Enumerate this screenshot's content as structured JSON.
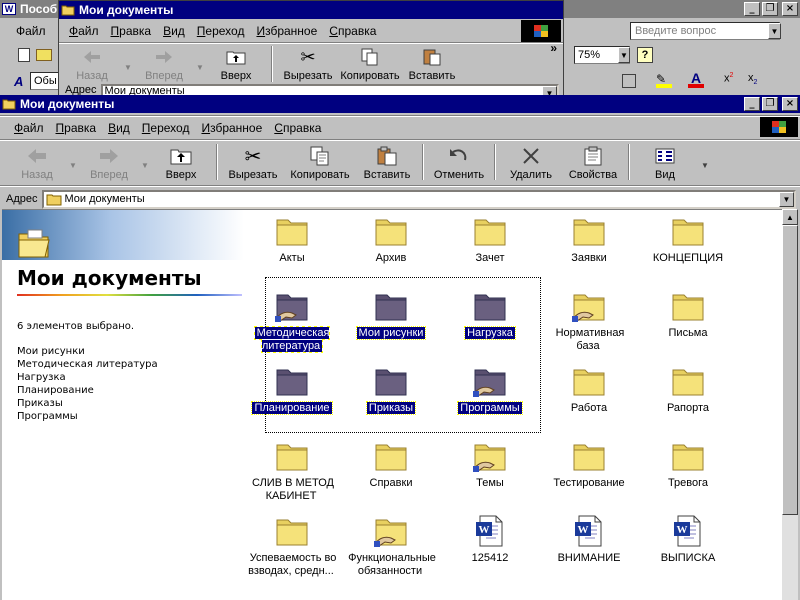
{
  "bg_word": {
    "title": "Пособ",
    "menu_file": "Файл",
    "toolbar2_label": "Обы",
    "help_placeholder": "Введите вопрос",
    "zoom": "75%"
  },
  "bg_explorer": {
    "title": "Мои документы",
    "menu": [
      "Файл",
      "Правка",
      "Вид",
      "Переход",
      "Избранное",
      "Справка"
    ],
    "toolbar": [
      "Назад",
      "Вперед",
      "Вверх",
      "Вырезать",
      "Копировать",
      "Вставить"
    ],
    "address_label": "Адрес",
    "address_value": "Мои документы",
    "more": "»"
  },
  "window": {
    "title": "Мои документы",
    "controls": [
      "_",
      "❐",
      "×"
    ],
    "menu": [
      "Файл",
      "Правка",
      "Вид",
      "Переход",
      "Избранное",
      "Справка"
    ],
    "toolbar": [
      {
        "label": "Назад",
        "icon": "back-arrow-icon"
      },
      {
        "label": "Вперед",
        "icon": "forward-arrow-icon"
      },
      {
        "label": "Вверх",
        "icon": "up-folder-icon"
      },
      {
        "label": "Вырезать",
        "icon": "scissors-icon"
      },
      {
        "label": "Копировать",
        "icon": "copy-icon"
      },
      {
        "label": "Вставить",
        "icon": "paste-icon"
      },
      {
        "label": "Отменить",
        "icon": "undo-icon"
      },
      {
        "label": "Удалить",
        "icon": "delete-x-icon"
      },
      {
        "label": "Свойства",
        "icon": "properties-icon"
      },
      {
        "label": "Вид",
        "icon": "view-grid-icon"
      }
    ],
    "address_label": "Адрес",
    "address_value": "Мои документы"
  },
  "left_pane": {
    "title": "Мои документы",
    "selection_count": "6 элементов выбрано.",
    "selected_items": [
      "Мои рисунки",
      "Методическая литература",
      "Нагрузка",
      "Планирование",
      "Приказы",
      "Программы"
    ]
  },
  "files": [
    {
      "name": "Акты",
      "type": "folder"
    },
    {
      "name": "Архив",
      "type": "folder"
    },
    {
      "name": "Зачет",
      "type": "folder"
    },
    {
      "name": "Заявки",
      "type": "folder"
    },
    {
      "name": "КОНЦЕПЦИЯ",
      "type": "folder"
    },
    {
      "name": "Методическая литература",
      "type": "shared-folder",
      "selected": true
    },
    {
      "name": "Мои рисунки",
      "type": "folder",
      "selected": true
    },
    {
      "name": "Нагрузка",
      "type": "folder",
      "selected": true
    },
    {
      "name": "Нормативная база",
      "type": "shared-folder"
    },
    {
      "name": "Письма",
      "type": "folder"
    },
    {
      "name": "Планирование",
      "type": "folder",
      "selected": true
    },
    {
      "name": "Приказы",
      "type": "folder",
      "selected": true
    },
    {
      "name": "Программы",
      "type": "shared-folder",
      "selected": true
    },
    {
      "name": "Работа",
      "type": "folder"
    },
    {
      "name": "Рапорта",
      "type": "folder"
    },
    {
      "name": "СЛИВ В МЕТОД КАБИНЕТ",
      "type": "folder"
    },
    {
      "name": "Справки",
      "type": "folder"
    },
    {
      "name": "Темы",
      "type": "shared-folder"
    },
    {
      "name": "Тестирование",
      "type": "folder"
    },
    {
      "name": "Тревога",
      "type": "folder"
    },
    {
      "name": "Успеваемость во взводах, средн...",
      "type": "folder"
    },
    {
      "name": "Функциональные обязанности",
      "type": "shared-folder"
    },
    {
      "name": "125412",
      "type": "word-doc"
    },
    {
      "name": "ВНИМАНИЕ",
      "type": "word-doc"
    },
    {
      "name": "ВЫПИСКА",
      "type": "word-doc"
    }
  ]
}
